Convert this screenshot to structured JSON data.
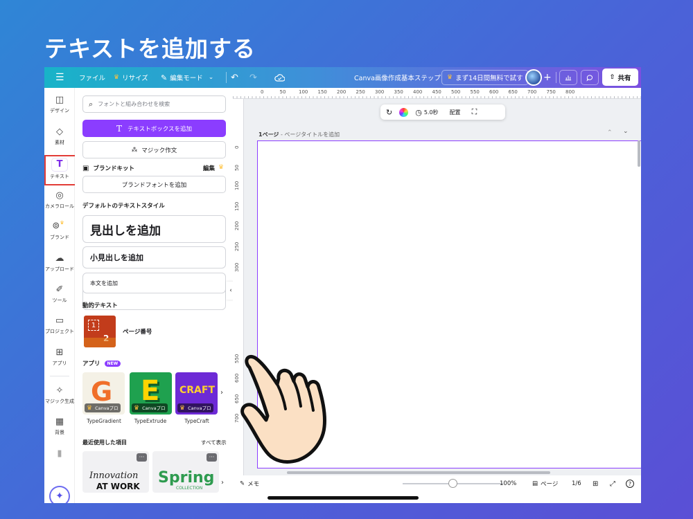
{
  "slide_title": "テキストを追加する",
  "topbar": {
    "menu_icon": "hamburger-icon",
    "file": "ファイル",
    "resize": "リサイズ",
    "edit_mode": "編集モード",
    "doc_title": "Canva画像作成基本ステップ",
    "trial": "まず14日間無料で試す",
    "share": "共有"
  },
  "rail": {
    "design": "デザイン",
    "elements": "素材",
    "text": "テキスト",
    "camera_roll": "カメラロール",
    "brand": "ブランド",
    "upload": "アップロード",
    "tools": "ツール",
    "projects": "プロジェクト",
    "apps": "アプリ",
    "magic": "マジック生成",
    "background": "背景"
  },
  "panel": {
    "search_placeholder": "フォントと組み合わせを検索",
    "add_textbox": "テキストボックスを追加",
    "magic_write": "マジック作文",
    "brand_kit": "ブランドキット",
    "brand_edit": "編集",
    "add_brand_font": "ブランドフォントを追加",
    "default_styles": "デフォルトのテキストスタイル",
    "heading": "見出しを追加",
    "subheading": "小見出しを追加",
    "body": "本文を追加",
    "dynamic_text": "動的テキスト",
    "page_number": "ページ番号",
    "dyn_num1": "1",
    "dyn_num2": "2",
    "apps_title": "アプリ",
    "new_badge": "NEW",
    "pro_label": "Canvaプロ",
    "apps": [
      {
        "name": "TypeGradient",
        "glyph": "G",
        "bg": "#f4f1e6"
      },
      {
        "name": "TypeExtrude",
        "glyph": "E",
        "bg": "#1fa14f"
      },
      {
        "name": "TypeCraft",
        "glyph": "CRAFT",
        "bg": "#6d2ad6"
      }
    ],
    "recent_title": "最近使用した項目",
    "show_all": "すべて表示",
    "recent_1a": "Innovation",
    "recent_1b": "AT WORK",
    "recent_2a": "Spring",
    "recent_2b": "COLLECTION"
  },
  "canvas": {
    "ruler_top": [
      "0",
      "50",
      "100",
      "150",
      "200",
      "250",
      "300",
      "350",
      "400",
      "450",
      "500",
      "550",
      "600",
      "650",
      "700",
      "750",
      "800"
    ],
    "ruler_left": [
      "0",
      "50",
      "100",
      "150",
      "200",
      "250",
      "300",
      "550",
      "600",
      "650",
      "700"
    ],
    "timer": "5.0秒",
    "position": "配置",
    "page_label": "1ページ",
    "page_title_placeholder": "ページタイトルを追加"
  },
  "footer": {
    "notes": "メモ",
    "zoom": "100%",
    "pages": "ページ",
    "page_count": "1/6"
  },
  "colors": {
    "accent": "#8b3dff",
    "highlight": "#e23b36"
  }
}
